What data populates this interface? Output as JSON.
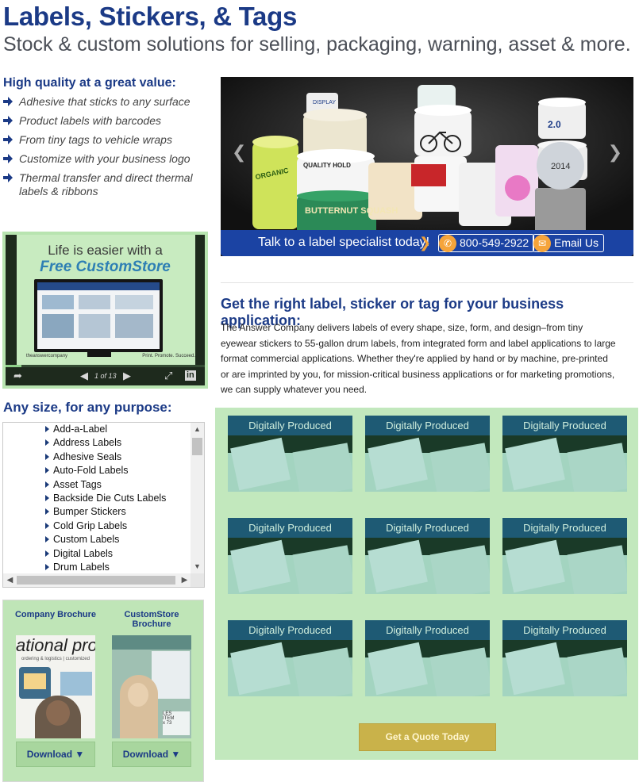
{
  "header": {
    "title": "Labels, Stickers, & Tags",
    "subtitle": "Stock & custom solutions for selling, packaging, warning, asset & more."
  },
  "quality": {
    "title": "High quality at a great value:",
    "items": [
      "Adhesive that sticks to any surface",
      "Product labels with barcodes",
      "From tiny tags to vehicle wraps",
      "Customize with your business logo",
      "Thermal transfer and direct thermal labels & ribbons"
    ]
  },
  "video": {
    "line1": "Life is easier with a",
    "line2": "Free CustomStore",
    "brand": "theanswercompany",
    "tagline": "Print. Promote. Succeed.",
    "pages": "1 of 13",
    "progress_fraction": 0.08
  },
  "sizes": {
    "title": "Any size, for any purpose:",
    "items": [
      "Add-a-Label",
      "Address Labels",
      "Adhesive Seals",
      "Auto-Fold Labels",
      "Asset Tags",
      "Backside Die Cuts Labels",
      "Bumper Stickers",
      "Cold Grip Labels",
      "Custom Labels",
      "Digital Labels",
      "Drum Labels"
    ]
  },
  "brochures": [
    {
      "title": "Company Brochure",
      "download": "Download"
    },
    {
      "title": "CustomStore Brochure",
      "download": "Download"
    }
  ],
  "hero": {
    "talk": "Talk to a label specialist today!",
    "phone": "800-549-2922",
    "email": "Email Us",
    "label_texts": [
      "DISPLAY",
      "QUALITY HOLD",
      "ORGANIC",
      "BUTTERNUT SQUASH",
      "2.0",
      "2014"
    ]
  },
  "main": {
    "title": "Get the right label, sticker or tag for your business application:",
    "description": "The Answer Company delivers labels of every shape, size, form, and design–from tiny eyewear stickers to 55-gallon drum labels, from integrated form and label applications to large format commercial applications. Whether they're applied by hand or by machine, pre-printed or are imprinted by you, for mission-critical business applications or for marketing promotions, we can supply whatever you need."
  },
  "grid": {
    "cards": [
      "Digitally Produced",
      "Digitally Produced",
      "Digitally Produced",
      "Digitally Produced",
      "Digitally Produced",
      "Digitally Produced",
      "Digitally Produced",
      "Digitally Produced",
      "Digitally Produced"
    ],
    "quote_button": "Get a Quote Today"
  },
  "colors": {
    "brand_blue": "#1b3a86",
    "accent_orange": "#f5a43a",
    "panel_green": "#c2e8bd",
    "quote_gold": "#c9b24a"
  }
}
